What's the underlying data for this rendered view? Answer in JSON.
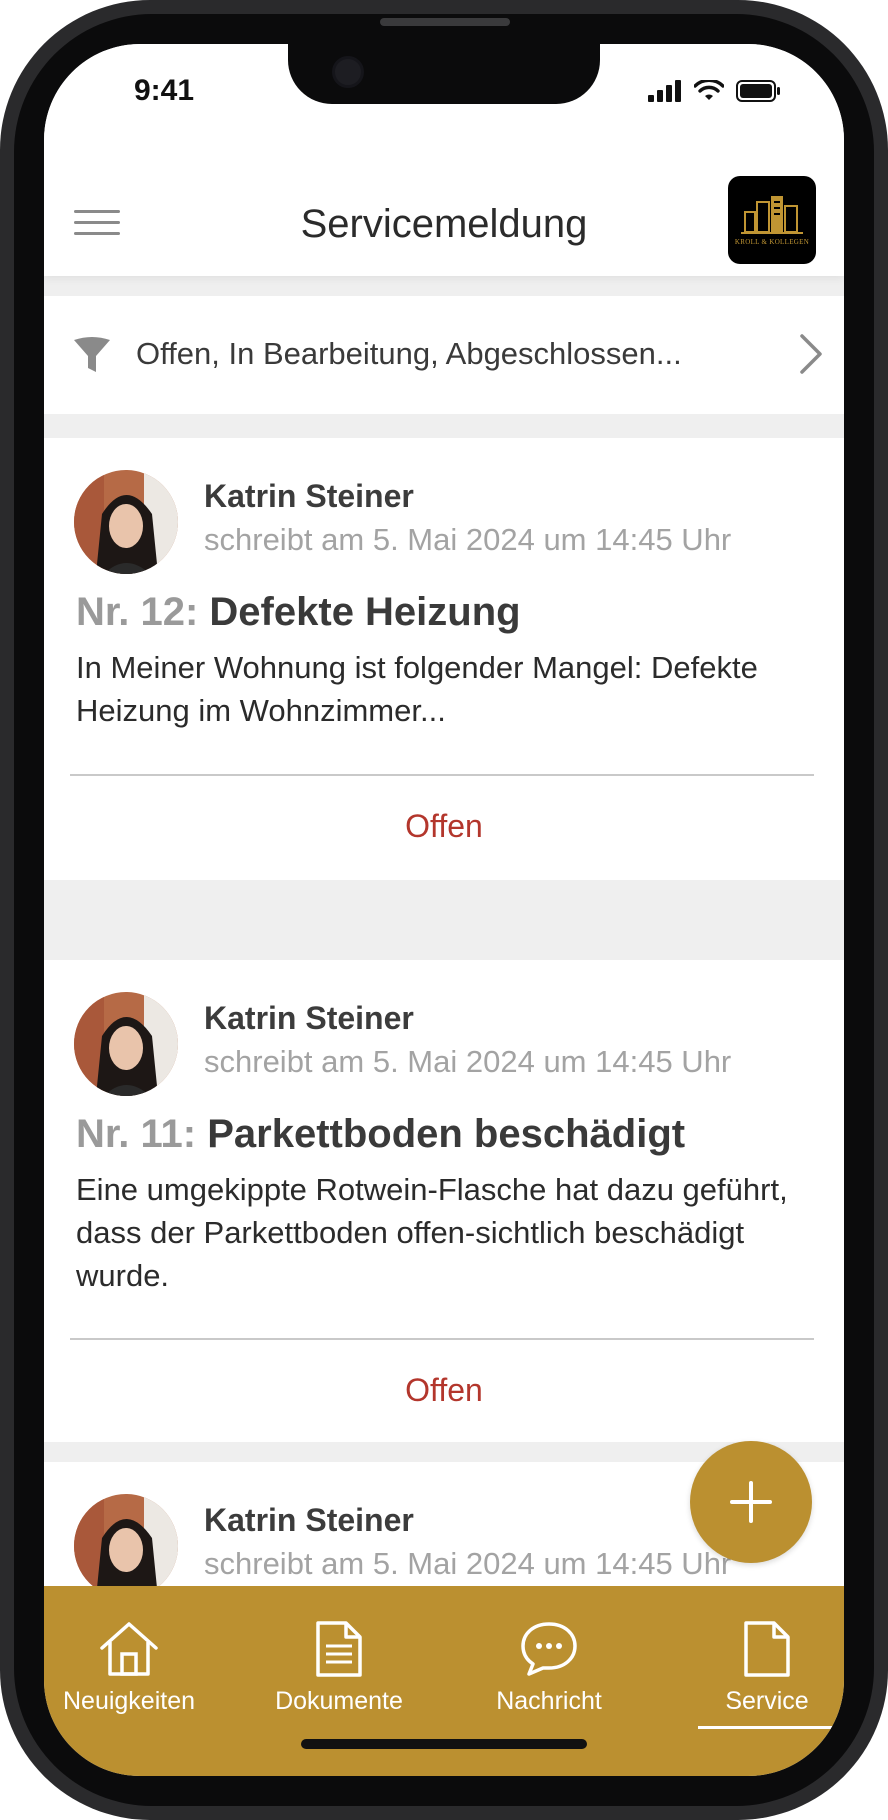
{
  "status_bar": {
    "time": "9:41"
  },
  "header": {
    "title": "Servicemeldung",
    "logo_text": "KROLL & KOLLEGEN"
  },
  "filter": {
    "text": "Offen, In Bearbeitung, Abgeschlossen..."
  },
  "tickets": [
    {
      "author": "Katrin Steiner",
      "meta": "schreibt am 5. Mai 2024 um 14:45 Uhr",
      "number": "Nr. 12:",
      "title": "Defekte Heizung",
      "body": "In Meiner Wohnung ist folgender Mangel: Defekte Heizung im Wohnzimmer...",
      "status": "Offen"
    },
    {
      "author": "Katrin Steiner",
      "meta": "schreibt am 5. Mai 2024 um 14:45 Uhr",
      "number": "Nr. 11:",
      "title": "Parkettboden beschädigt",
      "body": "Eine umgekippte Rotwein-Flasche hat dazu geführt, dass der Parkettboden offen-sichtlich beschädigt wurde.",
      "status": "Offen"
    },
    {
      "author": "Katrin Steiner",
      "meta": "schreibt am 5. Mai 2024 um 14:45 Uhr"
    }
  ],
  "tabbar": {
    "items": [
      {
        "label": "Neuigkeiten",
        "icon": "home-icon"
      },
      {
        "label": "Dokumente",
        "icon": "document-lines-icon"
      },
      {
        "label": "Nachricht",
        "icon": "chat-bubble-icon"
      },
      {
        "label": "Service",
        "icon": "document-icon"
      }
    ],
    "active": "Service"
  },
  "colors": {
    "accent": "#bb9030",
    "status_open": "#b3362c"
  }
}
